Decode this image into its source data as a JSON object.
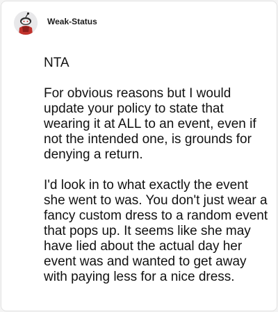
{
  "comment": {
    "author": "Weak-Status",
    "avatar_icon": "snoo-avatar-icon",
    "paragraphs": [
      "NTA",
      "For obvious reasons but I would update your policy to state that wearing it at ALL to an event, even if not the intended one, is grounds for denying a return.",
      "I'd look in to what exactly the event she went to was. You don't just wear a fancy custom dress to a random event that pops up. It seems like she may have lied about the actual day her event was and wanted to get away with paying less for a nice dress."
    ]
  },
  "colors": {
    "background": "#f4f4f4",
    "card": "#ffffff",
    "text": "#111111",
    "avatar_accent": "#c0322c"
  }
}
